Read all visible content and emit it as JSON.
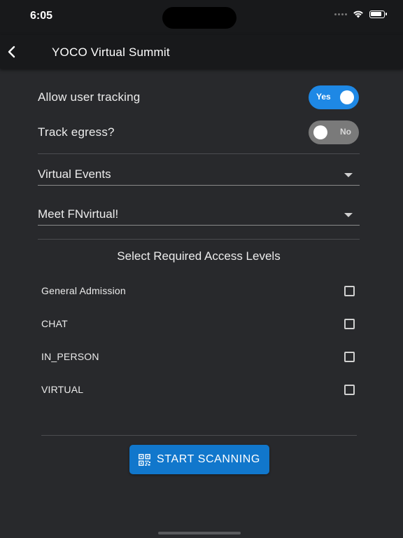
{
  "status_bar": {
    "time": "6:05"
  },
  "app_bar": {
    "title": "YOCO Virtual Summit",
    "back_icon": "chevron-left-icon"
  },
  "settings": {
    "allow_tracking": {
      "label": "Allow user tracking",
      "state": "Yes",
      "on": true
    },
    "track_egress": {
      "label": "Track egress?",
      "state": "No",
      "on": false
    }
  },
  "dropdowns": {
    "event_type": {
      "value": "Virtual Events"
    },
    "event": {
      "value": "Meet FNvirtual!"
    }
  },
  "access_levels": {
    "title": "Select Required Access Levels",
    "items": [
      {
        "label": "General Admission",
        "checked": false
      },
      {
        "label": "CHAT",
        "checked": false
      },
      {
        "label": "IN_PERSON",
        "checked": false
      },
      {
        "label": "VIRTUAL",
        "checked": false
      }
    ]
  },
  "actions": {
    "scan_label": "START SCANNING",
    "scan_icon": "qr-code-icon"
  },
  "colors": {
    "accent": "#1e88e5",
    "button": "#1177cc",
    "background": "#28292c",
    "bar": "#18191b"
  }
}
